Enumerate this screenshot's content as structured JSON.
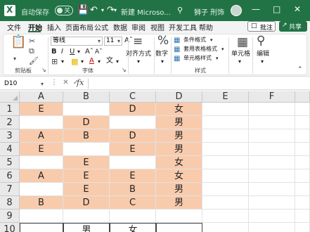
{
  "titlebar": {
    "autosave_label": "自动保存",
    "autosave_state": "关",
    "filename": "新建 Microso...",
    "user_name": "狮子 刑饰",
    "brand_color": "#217346"
  },
  "tabs": [
    "文件",
    "开始",
    "插入",
    "页面布局",
    "公式",
    "数据",
    "审阅",
    "视图",
    "开发工具",
    "帮助"
  ],
  "active_tab": "开始",
  "comment_btn": "批注",
  "share_btn": "共享",
  "ribbon": {
    "clipboard": {
      "label": "剪贴板"
    },
    "font": {
      "label": "字体",
      "font_name": "等线",
      "font_size": "11"
    },
    "alignment": {
      "label": "对齐方式"
    },
    "number": {
      "label": "数字"
    },
    "styles": {
      "label": "样式",
      "conditional": "条件格式",
      "table": "套用表格格式",
      "cell_styles": "单元格样式"
    },
    "cells": {
      "label": "单元格"
    },
    "editing": {
      "label": "编辑"
    }
  },
  "formula_bar": {
    "name_box": "D10",
    "fx": "fx",
    "value": ""
  },
  "grid": {
    "columns": [
      "A",
      "B",
      "C",
      "D",
      "E",
      "F"
    ],
    "rows": [
      "1",
      "2",
      "3",
      "4",
      "5",
      "6",
      "7",
      "8",
      "9",
      "10"
    ],
    "cells": [
      [
        "E",
        "",
        "D",
        "女",
        "",
        ""
      ],
      [
        "",
        "D",
        "",
        "男",
        "",
        ""
      ],
      [
        "A",
        "B",
        "D",
        "男",
        "",
        ""
      ],
      [
        "E",
        "",
        "E",
        "男",
        "",
        ""
      ],
      [
        "",
        "E",
        "",
        "女",
        "",
        ""
      ],
      [
        "A",
        "E",
        "E",
        "女",
        "",
        ""
      ],
      [
        "",
        "E",
        "B",
        "男",
        "",
        ""
      ],
      [
        "B",
        "D",
        "C",
        "男",
        "",
        ""
      ],
      [
        "",
        "",
        "",
        "",
        "",
        ""
      ],
      [
        "",
        "男",
        "女",
        "",
        "",
        ""
      ]
    ],
    "peach_color": "#f8cbad"
  }
}
